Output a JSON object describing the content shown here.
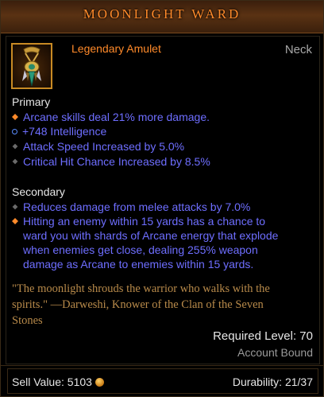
{
  "item": {
    "name": "Moonlight Ward",
    "type": "Legendary Amulet",
    "slot": "Neck",
    "icon": "amulet-icon"
  },
  "primary": {
    "title": "Primary",
    "props": [
      {
        "text": "Arcane skills deal 21% more damage.",
        "bullet": "orange-diamond"
      },
      {
        "text": "+748 Intelligence",
        "bullet": "blue-ring"
      },
      {
        "text": "Attack Speed Increased by 5.0%",
        "bullet": "grey-diamond"
      },
      {
        "text": "Critical Hit Chance Increased by 8.5%",
        "bullet": "grey-diamond"
      }
    ]
  },
  "secondary": {
    "title": "Secondary",
    "props": [
      {
        "lines": [
          "Reduces damage from melee attacks by 7.0%"
        ],
        "bullet": "grey-diamond"
      },
      {
        "lines": [
          "Hitting an enemy within 15 yards has a chance to",
          "ward you with shards of Arcane energy that explode",
          "when enemies get close, dealing 255% weapon",
          "damage as Arcane to enemies within 15 yards."
        ],
        "bullet": "orange-diamond"
      }
    ]
  },
  "flavor": {
    "lines": [
      "\"The moonlight shrouds the warrior who walks with the",
      "spirits.\" —Darweshi, Knower of the Clan of the Seven",
      "Stones"
    ]
  },
  "requirements": {
    "level": "Required Level: 70",
    "bound": "Account Bound"
  },
  "footer": {
    "sell_label": "Sell Value: 5103",
    "durability_label": "Durability: 21/37"
  },
  "colors": {
    "legendary": "#ff8a2a",
    "magic": "#6e6eff",
    "flavor": "#b88a4a"
  }
}
